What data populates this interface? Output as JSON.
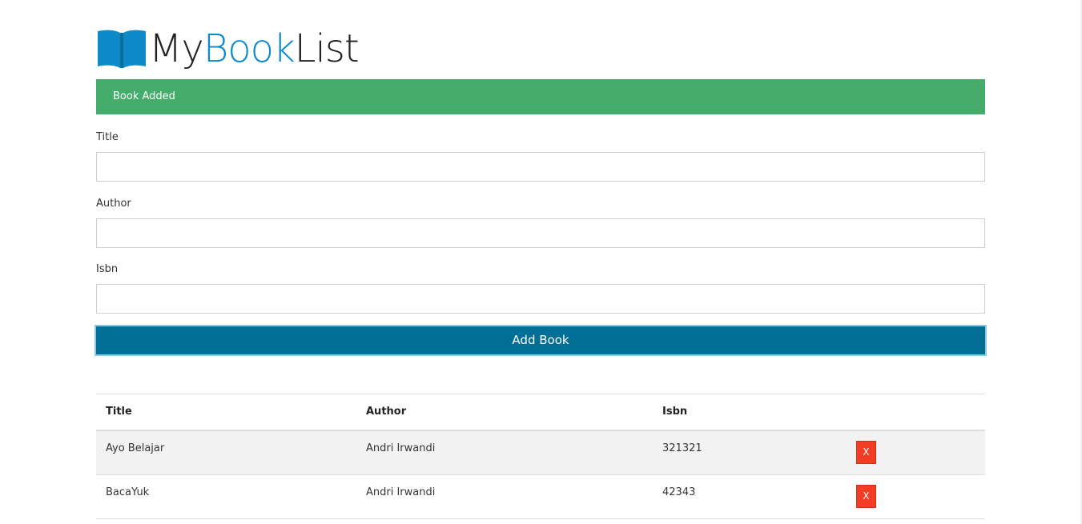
{
  "brand": {
    "part1": "My",
    "part2": "Book",
    "part3": "List",
    "accent_color": "#0d8ac7",
    "icon": "open-book-icon"
  },
  "alert": {
    "message": "Book Added",
    "color": "#45ad6b"
  },
  "form": {
    "title_label": "Title",
    "title_value": "",
    "author_label": "Author",
    "author_value": "",
    "isbn_label": "Isbn",
    "isbn_value": "",
    "submit_label": "Add Book",
    "submit_color": "#006e95"
  },
  "table": {
    "headers": [
      "Title",
      "Author",
      "Isbn"
    ],
    "rows": [
      {
        "title": "Ayo Belajar",
        "author": "Andri Irwandi",
        "isbn": "321321",
        "delete_label": "X"
      },
      {
        "title": "BacaYuk",
        "author": "Andri Irwandi",
        "isbn": "42343",
        "delete_label": "X"
      }
    ],
    "delete_color": "#f23c24"
  }
}
